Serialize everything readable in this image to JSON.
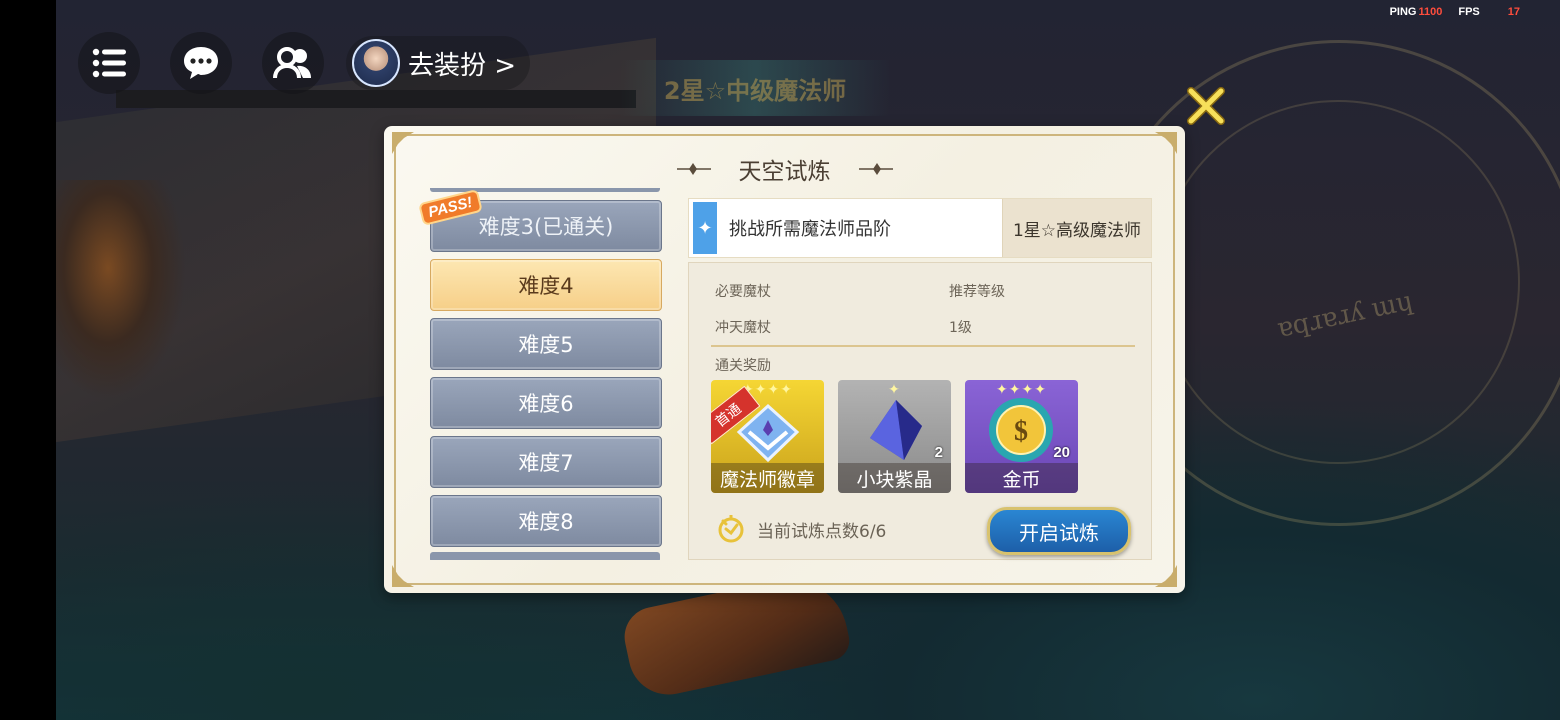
{
  "hud": {
    "profile_label": "去装扮 >",
    "perf_ping_label": "PING",
    "perf_ping_value": "1100",
    "perf_fps_label": "FPS",
    "perf_fps_value": "17"
  },
  "background": {
    "banner_text": "2星☆中级魔法师",
    "rune_text": "ɐqɹɐɹʎ ɯɥ"
  },
  "dialog": {
    "title": "天空试炼",
    "difficulties": [
      {
        "label": "难度3(已通关)",
        "state": "done",
        "badge": "PASS!"
      },
      {
        "label": "难度4",
        "state": "active"
      },
      {
        "label": "难度5",
        "state": "normal"
      },
      {
        "label": "难度6",
        "state": "normal"
      },
      {
        "label": "难度7",
        "state": "normal"
      },
      {
        "label": "难度8",
        "state": "normal"
      }
    ],
    "requirement": {
      "label": "挑战所需魔法师品阶",
      "value": "1星☆高级魔法师"
    },
    "info": {
      "wand_label": "必要魔杖",
      "wand_value": "冲天魔杖",
      "level_label": "推荐等级",
      "level_value": "1级",
      "rewards_label": "通关奖励"
    },
    "rewards": [
      {
        "name": "魔法师徽章",
        "count": "",
        "ribbon": "首通",
        "color": "#e6c52a",
        "stars": "✦✦✦✦"
      },
      {
        "name": "小块紫晶",
        "count": "2",
        "color": "#9b9b9b",
        "stars": "✦"
      },
      {
        "name": "金币",
        "count": "20",
        "color": "#7a56c8",
        "stars": "✦✦✦✦"
      }
    ],
    "points_text": "当前试炼点数6/6",
    "start_button": "开启试炼"
  },
  "colors": {
    "accent_blue": "#2a86d3",
    "gold_border": "#cdb57c",
    "active_tab": "#f6cf88"
  }
}
